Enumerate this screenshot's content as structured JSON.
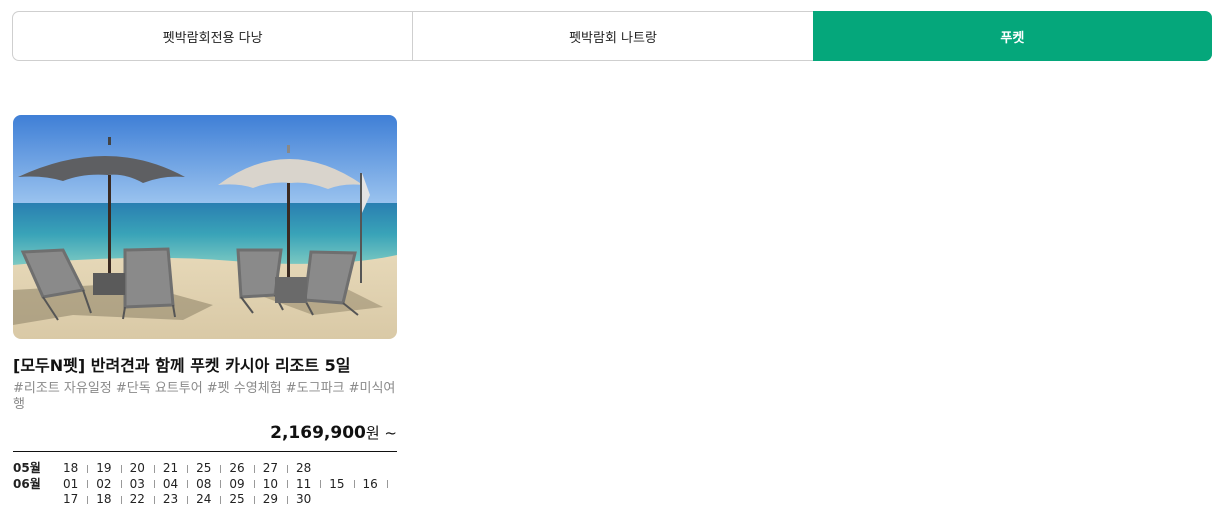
{
  "tabs": [
    {
      "label": "펫박람회전용 다낭",
      "active": false
    },
    {
      "label": "펫박람회 나트랑",
      "active": false
    },
    {
      "label": "푸켓",
      "active": true
    }
  ],
  "colors": {
    "accent": "#05a77b"
  },
  "product": {
    "title": "[모두N펫] 반려견과 함께 푸켓 카시아 리조트 5일",
    "tags": "#리조트 자유일정 #단독 요트투어 #펫 수영체험 #도그파크 #미식여행",
    "price": "2,169,900",
    "price_suffix": "원 ~",
    "image_alt": "beach-umbrellas-lounge-chairs"
  },
  "schedule": [
    {
      "month": "05월",
      "days": [
        "18",
        "19",
        "20",
        "21",
        "25",
        "26",
        "27",
        "28"
      ]
    },
    {
      "month": "06월",
      "days": [
        "01",
        "02",
        "03",
        "04",
        "08",
        "09",
        "10",
        "11",
        "15",
        "16",
        "17",
        "18",
        "22",
        "23",
        "24",
        "25",
        "29",
        "30"
      ]
    }
  ]
}
